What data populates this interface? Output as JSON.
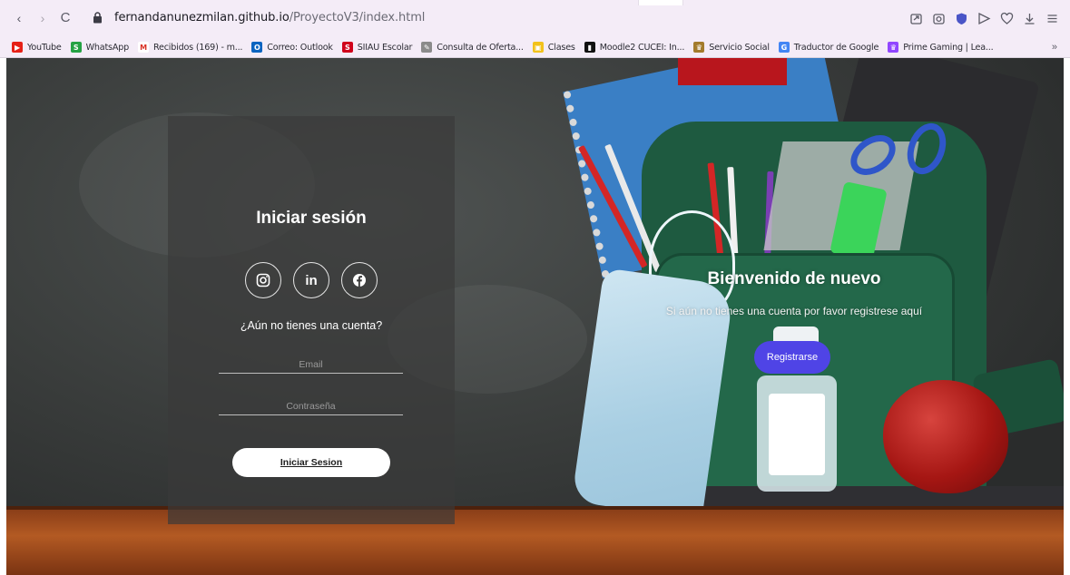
{
  "browser": {
    "url_domain": "fernandanunezmilan.github.io",
    "url_path": "/ProyectoV3/index.html",
    "nav": {
      "back": "‹",
      "forward": "›",
      "reload": "C"
    },
    "bookmarks": [
      {
        "label": "YouTube",
        "color": "#e62117",
        "glyph": "▶"
      },
      {
        "label": "WhatsApp",
        "color": "#25a244",
        "glyph": "S"
      },
      {
        "label": "Recibidos (169) - m...",
        "color": "#ffffff",
        "glyph": "M"
      },
      {
        "label": "Correo: Outlook",
        "color": "#0b64c0",
        "glyph": "O"
      },
      {
        "label": "SIIAU Escolar",
        "color": "#d0021b",
        "glyph": "S"
      },
      {
        "label": "Consulta de Oferta...",
        "color": "#8b8b8b",
        "glyph": "✎"
      },
      {
        "label": "Clases",
        "color": "#f2c21b",
        "glyph": "▣"
      },
      {
        "label": "Moodle2 CUCEI: In...",
        "color": "#111111",
        "glyph": "▮"
      },
      {
        "label": "Servicio Social",
        "color": "#a37b2c",
        "glyph": "♛"
      },
      {
        "label": "Traductor de Google",
        "color": "#4285f4",
        "glyph": "G"
      },
      {
        "label": "Prime Gaming | Lea...",
        "color": "#9146ff",
        "glyph": "♛"
      }
    ],
    "bookmarks_more": "»"
  },
  "login": {
    "title": "Iniciar sesión",
    "prompt": "¿Aún no tienes una cuenta?",
    "email_placeholder": "Email",
    "password_placeholder": "Contraseña",
    "submit_label": "Iniciar Sesion",
    "social": [
      "instagram",
      "linkedin",
      "facebook"
    ]
  },
  "welcome": {
    "title": "Bienvenido de nuevo",
    "subtitle": "Si aún no tienes una cuenta por favor registrese aquí",
    "register_label": "Registrarse",
    "accent": "#4f44e6"
  },
  "social_linkedin_text": "in"
}
